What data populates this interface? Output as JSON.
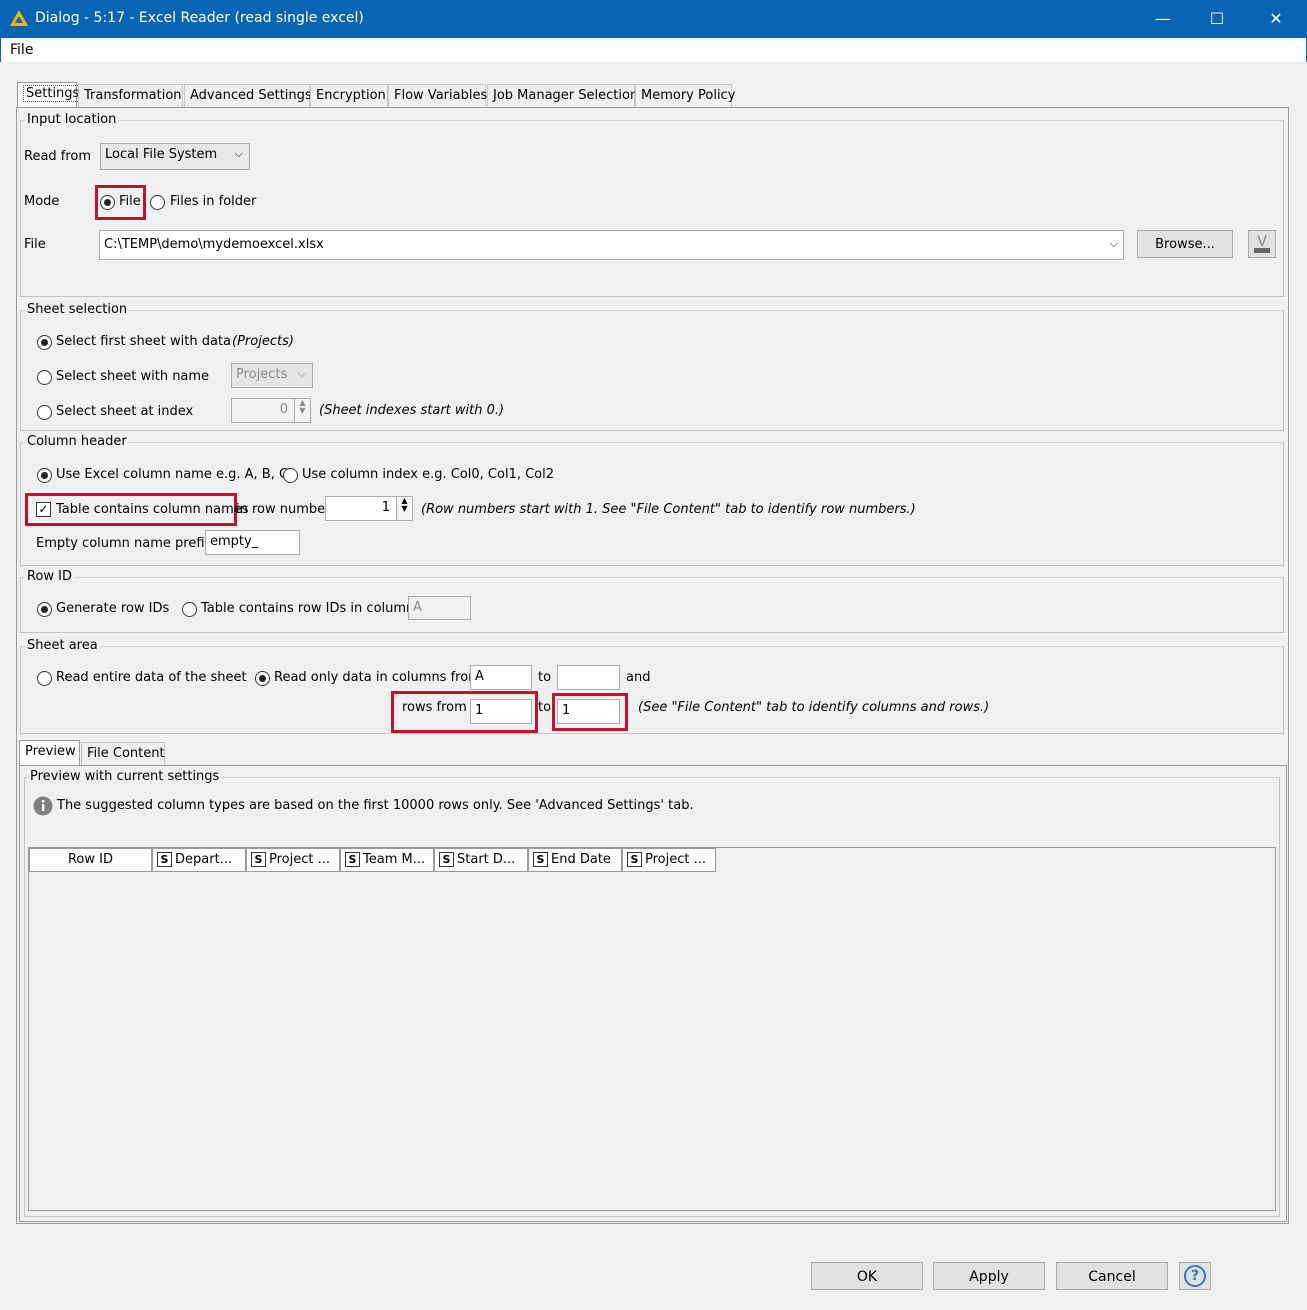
{
  "window": {
    "title": "Dialog - 5:17 - Excel Reader (read single excel)",
    "minimize": "—",
    "maximize": "☐",
    "close": "✕"
  },
  "menu": {
    "file": "File"
  },
  "tabs": [
    "Settings",
    "Transformation",
    "Advanced Settings",
    "Encryption",
    "Flow Variables",
    "Job Manager Selection",
    "Memory Policy"
  ],
  "input_location": {
    "legend": "Input location",
    "read_from_label": "Read from",
    "read_from_value": "Local File System",
    "mode_label": "Mode",
    "mode_file": "File",
    "mode_folder": "Files in folder",
    "file_label": "File",
    "file_path": "C:\\TEMP\\demo\\mydemoexcel.xlsx",
    "browse": "Browse..."
  },
  "sheet_selection": {
    "legend": "Sheet selection",
    "first": "Select first sheet with data",
    "first_hint": "(Projects)",
    "by_name": "Select sheet with name",
    "name_value": "Projects",
    "by_index": "Select sheet at index",
    "index_value": "0",
    "index_hint": "(Sheet indexes start with 0.)"
  },
  "column_header": {
    "legend": "Column header",
    "excel_name": "Use Excel column name e.g. A, B, C",
    "col_index": "Use column index e.g. Col0, Col1, Col2",
    "contains_names": "Table contains column names",
    "row_number_label": "in row number",
    "row_number_value": "1",
    "row_hint": "(Row numbers start with 1. See \"File Content\" tab to identify row numbers.)",
    "prefix_label": "Empty column name prefix:",
    "prefix_value": "empty_"
  },
  "row_id": {
    "legend": "Row ID",
    "generate": "Generate row IDs",
    "contains": "Table contains row IDs in column",
    "column_value": "A"
  },
  "sheet_area": {
    "legend": "Sheet area",
    "entire": "Read entire data of the sheet",
    "only": "Read only data in columns from",
    "col_from": "A",
    "to": "to",
    "col_to": "",
    "and": "and",
    "rows_from_label": "rows from",
    "rows_from": "1",
    "rows_to_label": "to",
    "rows_to": "1",
    "hint": "(See \"File Content\" tab to identify columns and rows.)"
  },
  "bottom_tabs": [
    "Preview",
    "File Content"
  ],
  "preview": {
    "legend": "Preview with current settings",
    "info": "The suggested column types are based on the first 10000 rows only. See 'Advanced Settings' tab.",
    "row_id_header": "Row ID",
    "type_badge": "S",
    "columns": [
      "Depart...",
      "Project ...",
      "Team M...",
      "Start D...",
      "End Date",
      "Project ..."
    ]
  },
  "buttons": {
    "ok": "OK",
    "apply": "Apply",
    "cancel": "Cancel",
    "help": "?"
  },
  "colors": {
    "titlebar": "#0a64b4",
    "highlight": "#c8102e",
    "help": "#2e7ad6"
  }
}
